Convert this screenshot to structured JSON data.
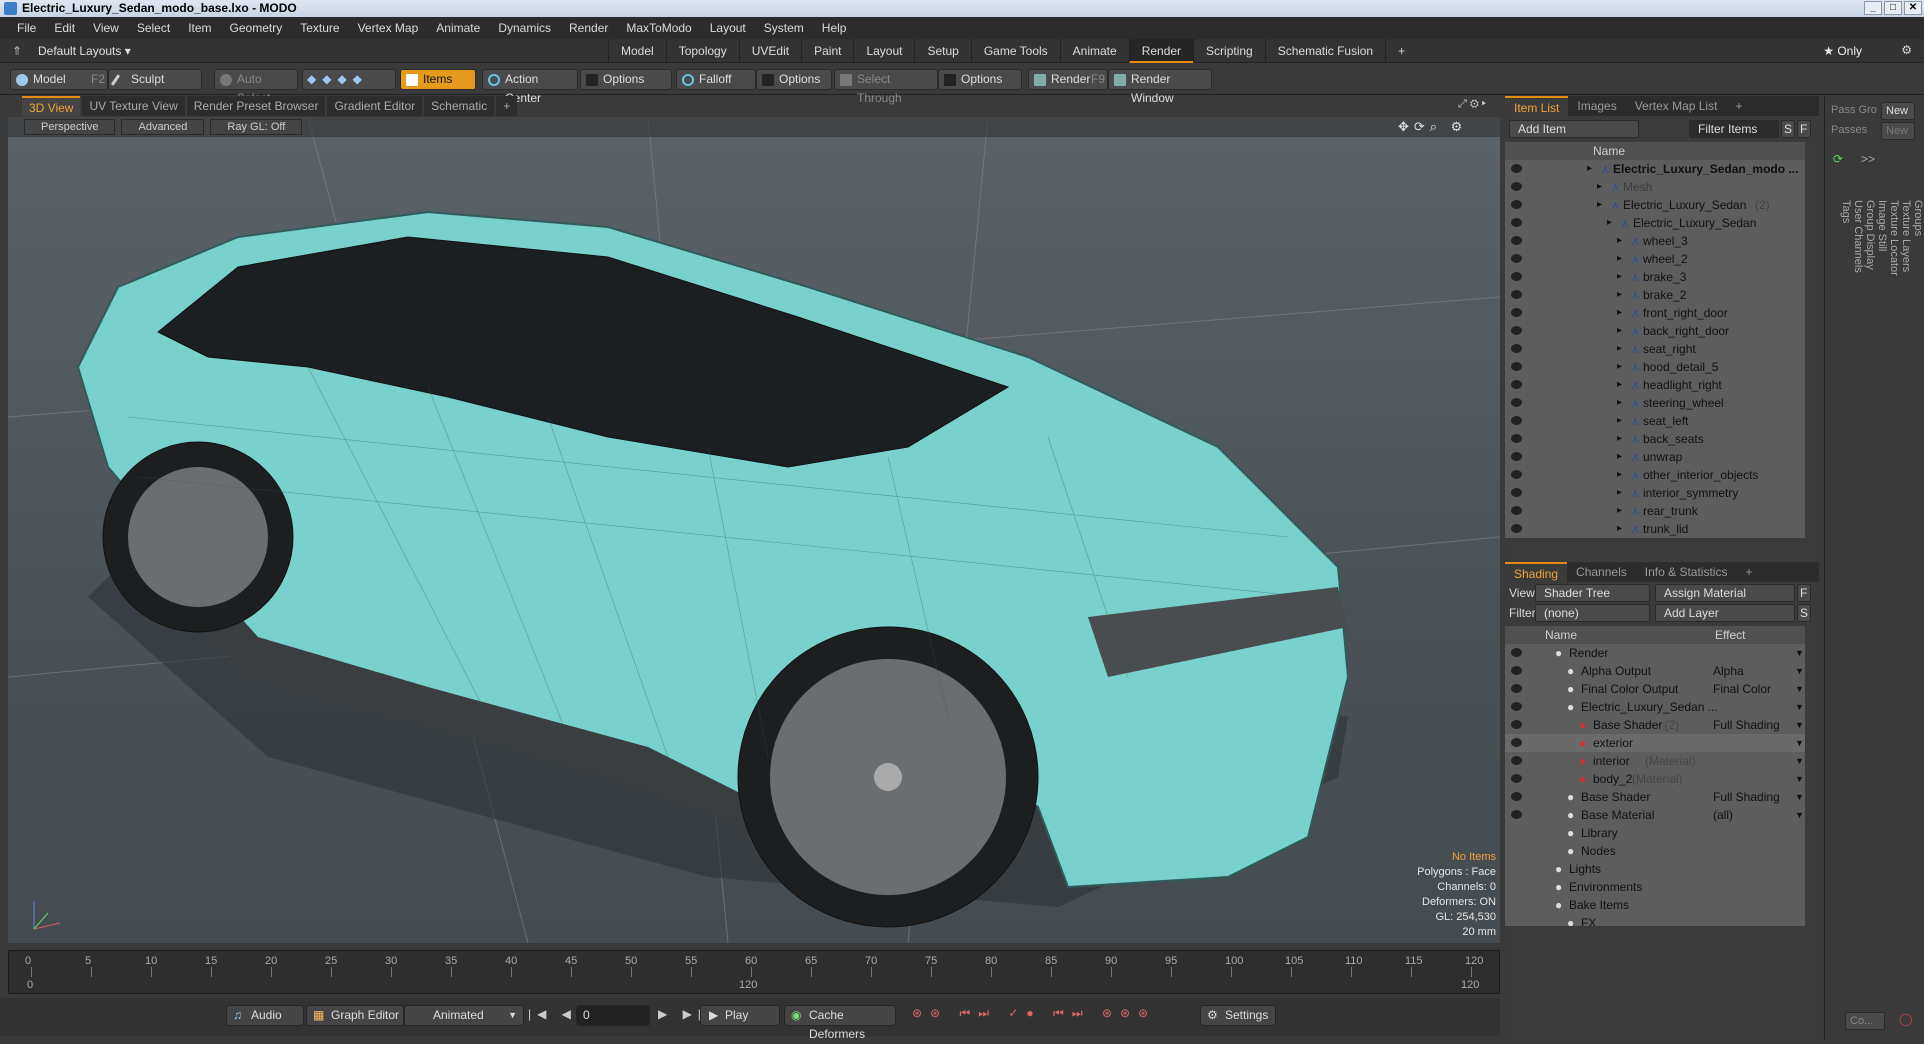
{
  "title": "Electric_Luxury_Sedan_modo_base.lxo - MODO",
  "menu": [
    "File",
    "Edit",
    "View",
    "Select",
    "Item",
    "Geometry",
    "Texture",
    "Vertex Map",
    "Animate",
    "Dynamics",
    "Render",
    "MaxToModo",
    "Layout",
    "System",
    "Help"
  ],
  "layout": {
    "selector": "Default Layouts ▾",
    "tabs": [
      "Model",
      "Topology",
      "UVEdit",
      "Paint",
      "Layout",
      "Setup",
      "Game Tools",
      "Animate",
      "Render",
      "Scripting",
      "Schematic Fusion",
      "+"
    ],
    "active_tab": "Render",
    "only": "★ Only"
  },
  "toolbar": {
    "model": "Model",
    "model_key": "F2",
    "sculpt": "Sculpt",
    "auto_select": "Auto Select",
    "items": "Items",
    "action_center": "Action Center",
    "options1": "Options",
    "falloff": "Falloff",
    "options2": "Options",
    "select_through": "Select Through",
    "options3": "Options",
    "render": "Render",
    "render_key": "F9",
    "render_window": "Render Window"
  },
  "viewport_tabs": [
    "3D View",
    "UV Texture View",
    "Render Preset Browser",
    "Gradient Editor",
    "Schematic",
    "+"
  ],
  "viewport": {
    "perspective": "Perspective",
    "advanced": "Advanced",
    "raygl": "Ray GL: Off"
  },
  "hud": [
    "No Items",
    "Polygons : Face",
    "Channels: 0",
    "Deformers: ON",
    "GL: 254,530",
    "20 mm"
  ],
  "timeline": {
    "ticks": [
      "0",
      "5",
      "10",
      "15",
      "20",
      "25",
      "30",
      "35",
      "40",
      "45",
      "50",
      "55",
      "60",
      "65",
      "70",
      "75",
      "80",
      "85",
      "90",
      "95",
      "100",
      "105",
      "110",
      "115",
      "120"
    ],
    "start": "0",
    "mid": "120",
    "end": "120"
  },
  "bottom": {
    "audio": "Audio",
    "graph_editor": "Graph Editor",
    "animated": "Animated",
    "frame": "0",
    "play": "Play",
    "cache": "Cache Deformers",
    "settings": "Settings"
  },
  "item_list": {
    "tabs": [
      "Item List",
      "Images",
      "Vertex Map List",
      "+"
    ],
    "add_item": "Add Item",
    "filter": "Filter Items",
    "s": "S",
    "f": "F",
    "col_name": "Name",
    "rows": [
      {
        "name": "Electric_Luxury_Sedan_modo ...",
        "indent": 0,
        "bold": true
      },
      {
        "name": "Mesh",
        "indent": 1,
        "faint": true
      },
      {
        "name": "Electric_Luxury_Sedan",
        "count": "(2)",
        "indent": 1
      },
      {
        "name": "Electric_Luxury_Sedan",
        "indent": 2
      },
      {
        "name": "wheel_3",
        "indent": 3
      },
      {
        "name": "wheel_2",
        "indent": 3
      },
      {
        "name": "brake_3",
        "indent": 3
      },
      {
        "name": "brake_2",
        "indent": 3
      },
      {
        "name": "front_right_door",
        "indent": 3
      },
      {
        "name": "back_right_door",
        "indent": 3
      },
      {
        "name": "seat_right",
        "indent": 3
      },
      {
        "name": "hood_detail_5",
        "indent": 3
      },
      {
        "name": "headlight_right",
        "indent": 3
      },
      {
        "name": "steering_wheel",
        "indent": 3
      },
      {
        "name": "seat_left",
        "indent": 3
      },
      {
        "name": "back_seats",
        "indent": 3
      },
      {
        "name": "unwrap",
        "indent": 3
      },
      {
        "name": "other_interior_objects",
        "indent": 3
      },
      {
        "name": "interior_symmetry",
        "indent": 3
      },
      {
        "name": "rear_trunk",
        "indent": 3
      },
      {
        "name": "trunk_lid",
        "indent": 3
      }
    ]
  },
  "shading": {
    "tabs": [
      "Shading",
      "Channels",
      "Info & Statistics",
      "+"
    ],
    "view_label": "View",
    "view_value": "Shader Tree",
    "assign": "Assign Material",
    "f": "F",
    "filter_label": "Filter",
    "filter_value": "(none)",
    "add_layer": "Add Layer",
    "s": "S",
    "col_name": "Name",
    "col_effect": "Effect",
    "rows": [
      {
        "name": "Render",
        "indent": 0,
        "effect": ""
      },
      {
        "name": "Alpha Output",
        "indent": 1,
        "effect": "Alpha"
      },
      {
        "name": "Final Color Output",
        "indent": 1,
        "effect": "Final Color"
      },
      {
        "name": "Electric_Luxury_Sedan ...",
        "indent": 1,
        "effect": ""
      },
      {
        "name": "Base Shader",
        "note": "(2)",
        "indent": 2,
        "effect": "Full Shading"
      },
      {
        "name": "exterior",
        "indent": 2,
        "effect": "",
        "sel": true
      },
      {
        "name": "interior",
        "note": "(Material)",
        "indent": 2,
        "effect": ""
      },
      {
        "name": "body_2",
        "note": "(Material)",
        "indent": 2,
        "effect": ""
      },
      {
        "name": "Base Shader",
        "indent": 1,
        "effect": "Full Shading"
      },
      {
        "name": "Base Material",
        "indent": 1,
        "effect": "(all)"
      },
      {
        "name": "Library",
        "indent": 1,
        "effect": ""
      },
      {
        "name": "Nodes",
        "indent": 1,
        "effect": ""
      },
      {
        "name": "Lights",
        "indent": 0,
        "effect": ""
      },
      {
        "name": "Environments",
        "indent": 0,
        "effect": ""
      },
      {
        "name": "Bake Items",
        "indent": 0,
        "effect": ""
      },
      {
        "name": "FX",
        "indent": 1,
        "effect": ""
      }
    ]
  },
  "far_right": {
    "pass_group": "Pass Gro",
    "passes": "Passes",
    "new1": "New",
    "new2": "New",
    "co": "Co...",
    "vertical_tabs": [
      "Groups",
      "Texture Layers",
      "Texture Locator",
      "Image Still",
      "Group Display",
      "User Channels",
      "Tags"
    ]
  },
  "colors": {
    "accent": "#e38b13",
    "car_body": "#78d1cc"
  }
}
